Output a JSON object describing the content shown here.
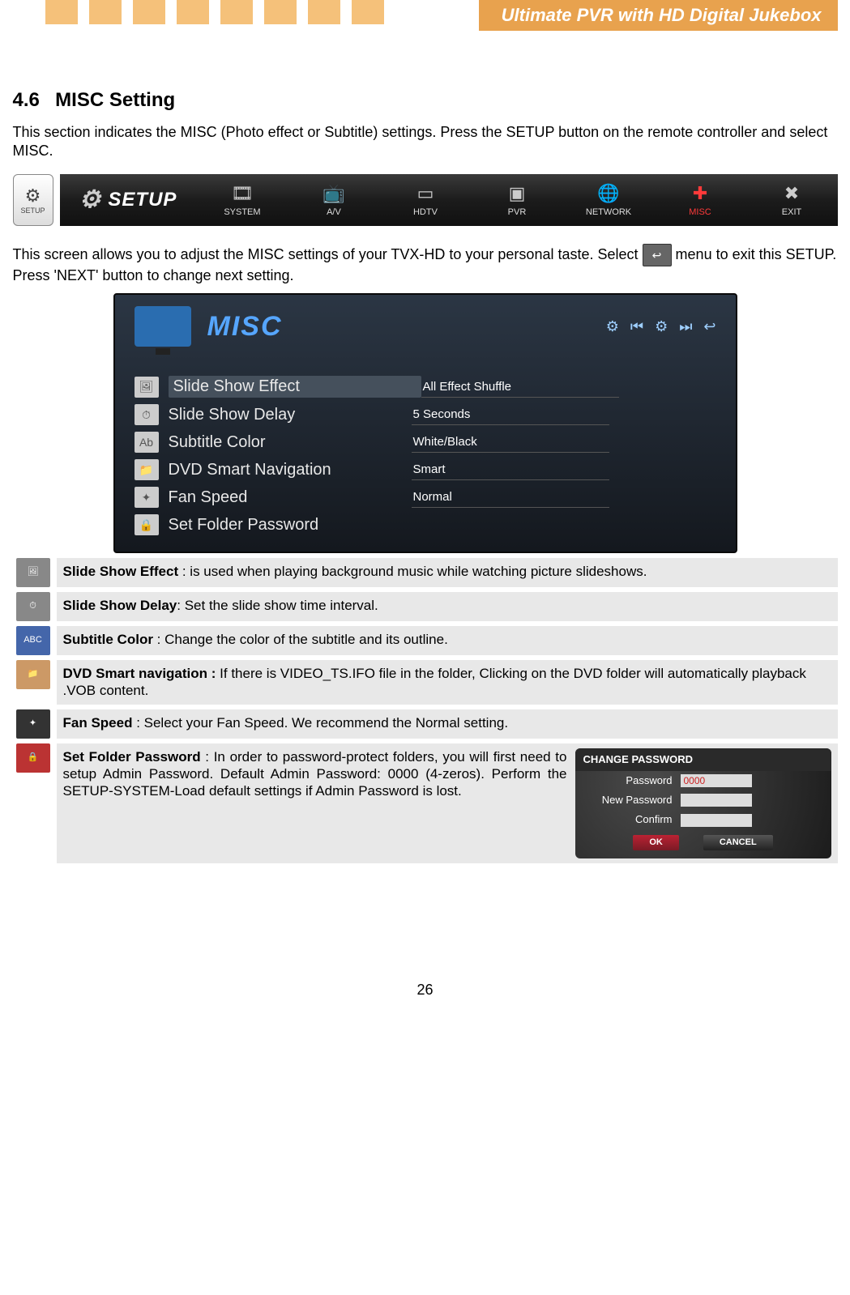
{
  "header": {
    "banner": "Ultimate PVR with HD Digital Jukebox"
  },
  "heading": {
    "num": "4.6",
    "title": "MISC Setting"
  },
  "intro": "This section indicates the MISC (Photo effect or Subtitle) settings. Press the SETUP button on the remote controller and select MISC.",
  "remote_btn": "SETUP",
  "toolbar": {
    "logo": "SETUP",
    "items": [
      "SYSTEM",
      "A/V",
      "HDTV",
      "PVR",
      "NETWORK",
      "MISC",
      "EXIT"
    ]
  },
  "para2a": "This screen allows you to adjust the MISC settings of your TVX-HD to your personal taste. Select",
  "para2b": "menu to exit this SETUP. Press 'NEXT' button to change next setting.",
  "misc": {
    "title": "MISC",
    "rows": [
      {
        "label": "Slide Show Effect",
        "value": "All Effect Shuffle"
      },
      {
        "label": "Slide Show Delay",
        "value": "5 Seconds"
      },
      {
        "label": "Subtitle Color",
        "value": "White/Black"
      },
      {
        "label": "DVD Smart Navigation",
        "value": "Smart"
      },
      {
        "label": "Fan Speed",
        "value": "Normal"
      },
      {
        "label": "Set Folder Password",
        "value": ""
      }
    ]
  },
  "desc": [
    {
      "b": "Slide Show Effect",
      "t": " : is used when playing background music while watching picture slideshows."
    },
    {
      "b": "Slide Show Delay",
      "t": ": Set the slide show time interval."
    },
    {
      "b": "Subtitle Color",
      "t": " : Change the color of the subtitle and its outline."
    },
    {
      "b": "DVD Smart navigation :",
      "t": " If there is VIDEO_TS.IFO file in the folder,   Clicking on the DVD folder will automatically playback .VOB content."
    },
    {
      "b": "Fan Speed",
      "t": " : Select your Fan Speed. We recommend the Normal setting."
    },
    {
      "b": "Set Folder Password",
      "t": " : In order to password-protect folders, you will first need to setup Admin Password. Default Admin Password: 0000 (4-zeros). Perform the SETUP-SYSTEM-Load default settings if Admin Password is lost."
    }
  ],
  "pw": {
    "title": "CHANGE PASSWORD",
    "fields": [
      {
        "label": "Password",
        "value": "0000"
      },
      {
        "label": "New Password",
        "value": ""
      },
      {
        "label": "Confirm",
        "value": ""
      }
    ],
    "ok": "OK",
    "cancel": "CANCEL"
  },
  "page_number": "26"
}
